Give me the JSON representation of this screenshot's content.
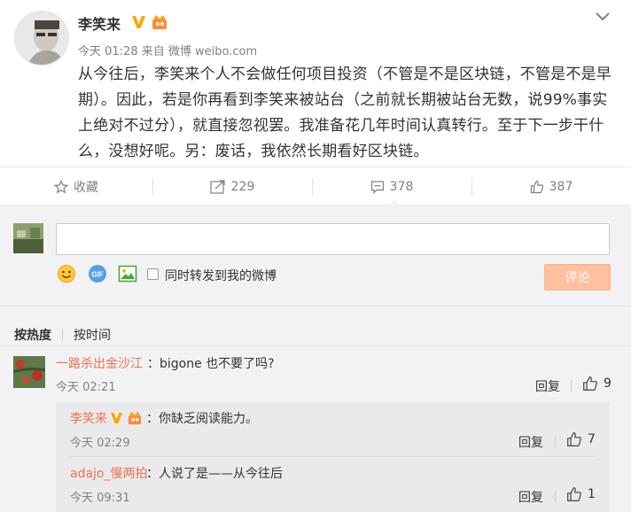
{
  "post": {
    "author": "李笑来",
    "time": "今天 01:28",
    "source_prefix": "来自",
    "source": "微博 weibo.com",
    "text": "从今往后，李笑来个人不会做任何项目投资（不管是不是区块链，不管是不是早期）。因此，若是你再看到李笑来被站台（之前就长期被站台无数，说99%事实上绝对不过分），就直接忽视罢。我准备花几年时间认真转行。至于下一步干什么，没想好呢。另：废话，我依然长期看好区块链。"
  },
  "actions": {
    "favorite_label": "收藏",
    "repost_count": "229",
    "comment_count": "378",
    "like_count": "387"
  },
  "composer": {
    "repost_label": "同时转发到我的微博",
    "submit_label": "评论"
  },
  "sort": {
    "hot_label": "按热度",
    "time_label": "按时间"
  },
  "comments": [
    {
      "name": "一路杀出金沙江",
      "text": "bigone 也不要了吗?",
      "time": "今天 02:21",
      "reply_label": "回复",
      "likes": "9",
      "replies": [
        {
          "name": "李笑来",
          "text": "你缺乏阅读能力。",
          "time": "今天 02:29",
          "reply_label": "回复",
          "likes": "7"
        },
        {
          "name": "adajo_慢两拍",
          "text": "人说了是——从今往后",
          "time": "今天 09:31",
          "reply_label": "回复",
          "likes": "1"
        }
      ]
    }
  ],
  "colors": {
    "name_orange": "#eb7350",
    "submit_bg": "#ffc09f",
    "verified_gold": "#f8a700",
    "comment_bg": "#f2f2f5"
  }
}
